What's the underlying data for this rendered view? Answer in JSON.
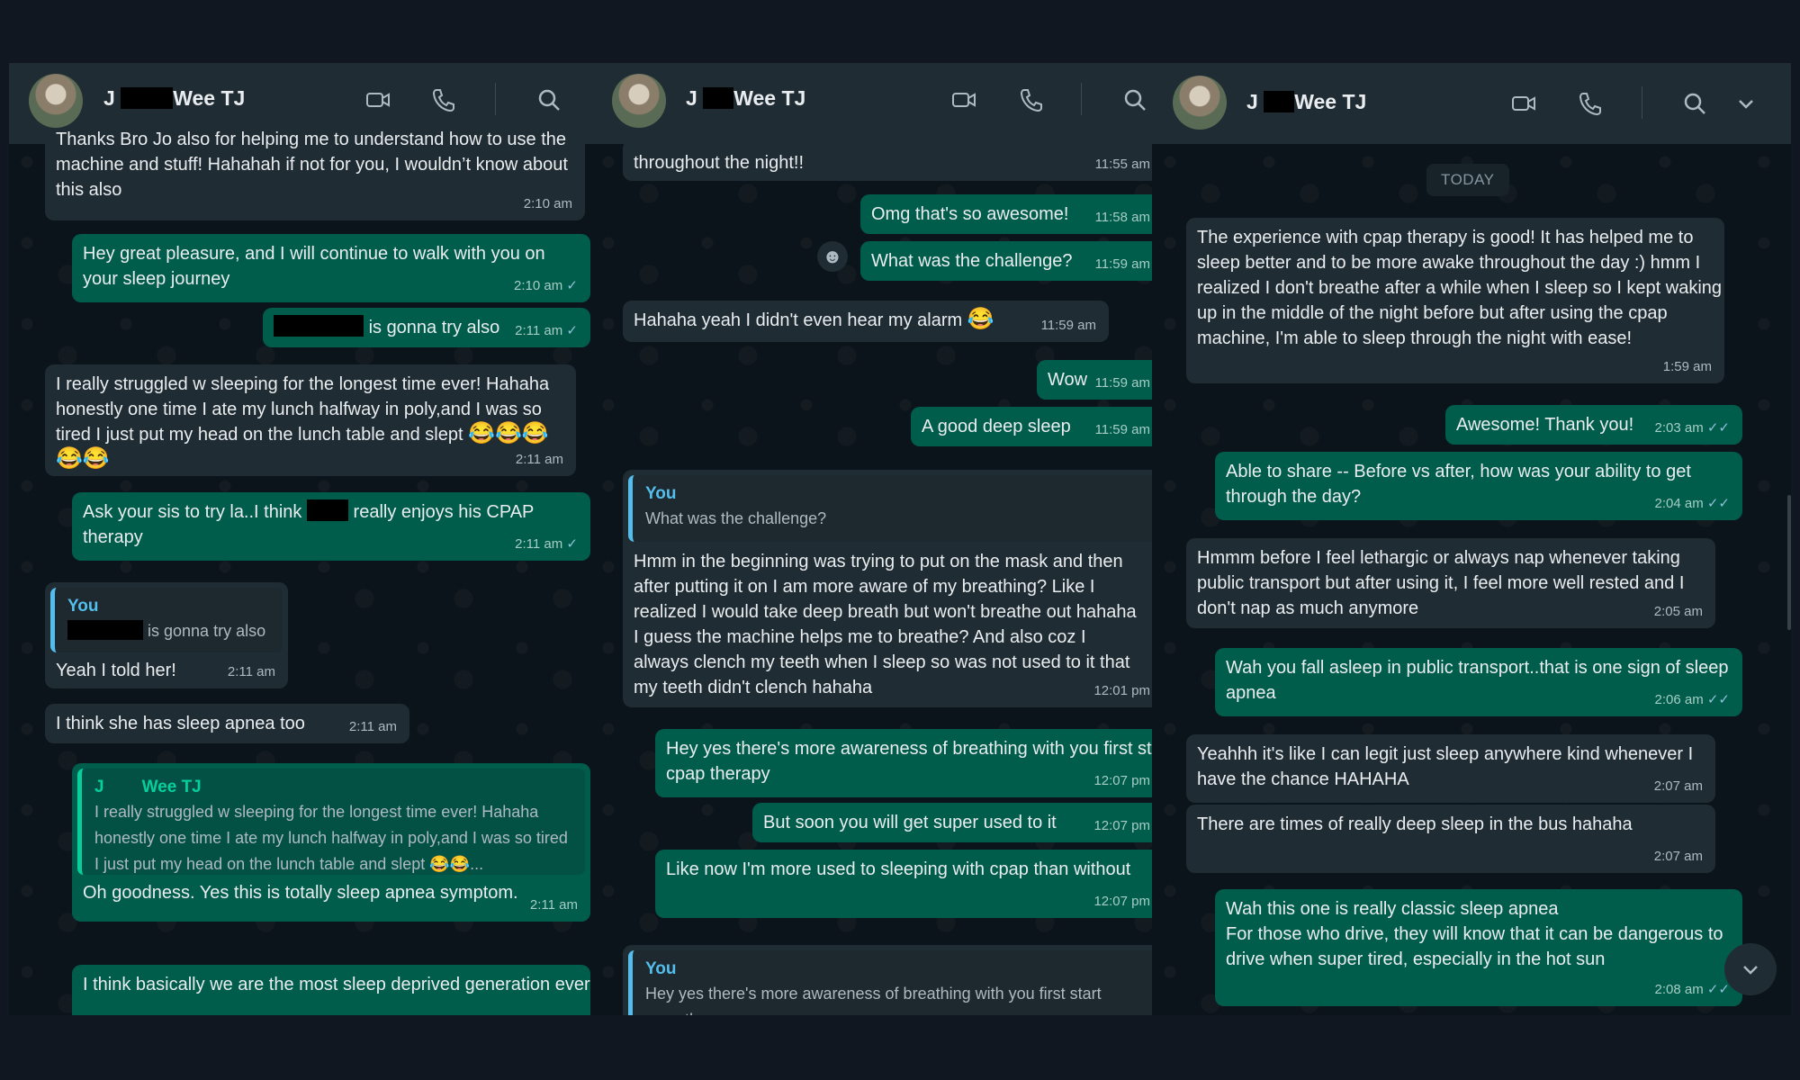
{
  "contact": {
    "first": "J",
    "last": "Wee TJ"
  },
  "panel1": {
    "m1": {
      "text": "Thanks Bro Jo     also for helping me to understand how to use the machine and stuff! Hahahah if not for you, I wouldn’t know about this also",
      "time": "2:10 am"
    },
    "m2": {
      "text": "Hey great pleasure, and I will continue to walk with you on your sleep journey",
      "time": "2:10 am"
    },
    "m3": {
      "text": "is gonna try also",
      "time": "2:11 am"
    },
    "m4": {
      "text": "I really struggled w sleeping for the longest time ever! Hahaha honestly one time I ate my lunch halfway in poly,and I was so tired I just put my head on the lunch table and slept",
      "emoji": "😂😂😂😂😂",
      "time": "2:11 am"
    },
    "m5": {
      "pre": "Ask your sis to try la..I think",
      "post": "really enjoys his CPAP therapy",
      "time": "2:11 am"
    },
    "m6": {
      "quote_name": "You",
      "quote_text": "is gonna try also",
      "text": "Yeah I told her!",
      "time": "2:11 am"
    },
    "m7": {
      "text": "I think she has sleep apnea too",
      "time": "2:11 am"
    },
    "m8": {
      "quote_name_a": "J",
      "quote_name_b": "Wee TJ",
      "quote_text": "I really struggled w sleeping for the longest time ever! Hahaha honestly one time I ate my lunch halfway in poly,and I was so tired I just put my head on the lunch table and slept 😂😂...",
      "text": "Oh goodness. Yes this is totally sleep apnea symptom.",
      "time": "2:11 am"
    },
    "m9": {
      "text": "I think basically we are the most sleep deprived generation ever"
    }
  },
  "panel2": {
    "m1": {
      "text": "throughout the night!!",
      "time": "11:55 am"
    },
    "m2": {
      "text": "Omg that's so awesome!",
      "time": "11:58 am"
    },
    "m3": {
      "text": "What was the challenge?",
      "time": "11:59 am"
    },
    "m4": {
      "text": "Hahaha yeah I didn't even hear my alarm",
      "emoji": "😂",
      "time": "11:59 am"
    },
    "m5": {
      "text": "Wow",
      "time": "11:59 am"
    },
    "m6": {
      "text": "A good deep sleep",
      "time": "11:59 am"
    },
    "m7": {
      "quote_name": "You",
      "quote_text": "What was the challenge?",
      "text": "Hmm in the beginning was trying to put on the mask and then after putting it on I am more aware of my breathing? Like I realized I would take deep breath but won't breathe out hahaha I guess the machine helps me to breathe? And also coz I always clench my teeth when I sleep so was not used to it that my teeth didn't clench hahaha",
      "time": "12:01 pm"
    },
    "m8": {
      "text": "Hey yes there's more awareness of breathing with you first start cpap therapy",
      "time": "12:07 pm"
    },
    "m9": {
      "text": "But soon you will get super used to it",
      "time": "12:07 pm"
    },
    "m10": {
      "text": "Like now I'm more used to sleeping with cpap than without",
      "time": "12:07 pm"
    },
    "m11": {
      "quote_name": "You",
      "quote_text": "Hey yes there's more awareness of breathing with you first start cpap therapy"
    }
  },
  "panel3": {
    "date": "TODAY",
    "m1": {
      "text": "The experience with cpap therapy is good! It has helped me to sleep better and to be more awake throughout the day :) hmm I realized I don't breathe after a while when I sleep so I kept waking up in the middle of the night before but after using the cpap machine, I'm able to sleep through the night with ease!",
      "time": "1:59 am"
    },
    "m2": {
      "text": "Awesome! Thank you!",
      "time": "2:03 am"
    },
    "m3": {
      "text": "Able to share -- Before vs after, how was your ability to get through the day?",
      "time": "2:04 am"
    },
    "m4": {
      "text": "Hmmm before I feel lethargic or always nap whenever taking public transport but after using it, I feel more well rested and I don't nap as much anymore",
      "time": "2:05 am"
    },
    "m5": {
      "text": "Wah you fall asleep in public transport..that is one sign of sleep apnea",
      "time": "2:06 am"
    },
    "m6": {
      "text": "Yeahhh it's like I can legit just sleep anywhere kind whenever I have the chance HAHAHA",
      "time": "2:07 am"
    },
    "m7": {
      "text": "There are times of really deep sleep in the bus hahaha",
      "time": "2:07 am"
    },
    "m8": {
      "line1": "Wah this one is really classic sleep apnea",
      "text": "For those who drive, they will know that it can be dangerous to drive when super tired, especially in the hot sun",
      "time": "2:08 am"
    }
  },
  "icons": [
    "video-call-icon",
    "phone-call-icon",
    "search-icon",
    "chevron-down-icon",
    "double-check-icon"
  ],
  "colors": {
    "incoming": "#202c33",
    "outgoing": "#005c4b",
    "chat_bg": "#0b141a",
    "header": "#202c33",
    "quote_you": "#53bdeb"
  }
}
